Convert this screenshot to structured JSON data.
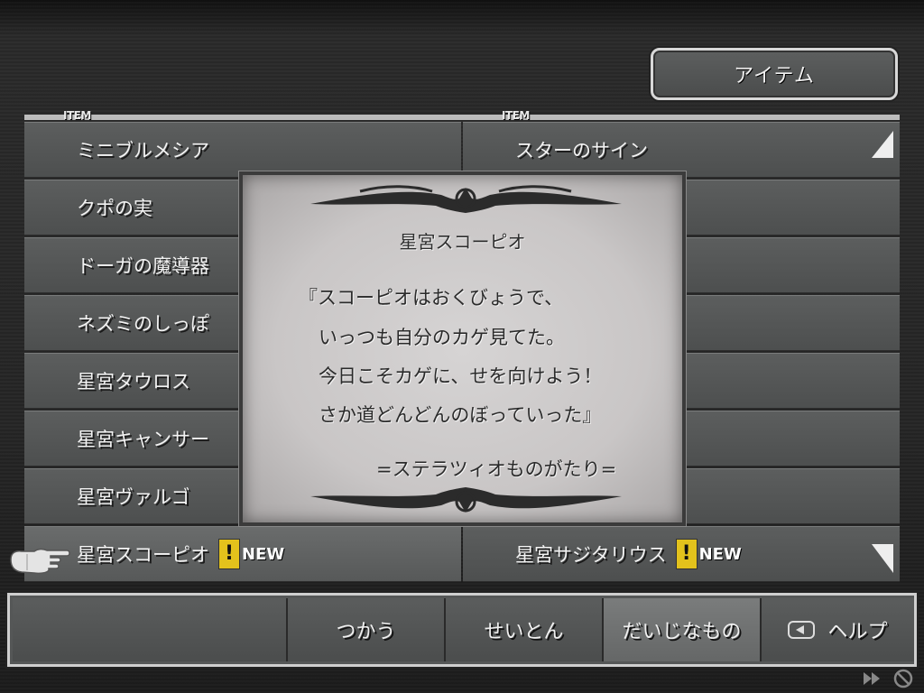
{
  "header": {
    "tab_label": "アイテム"
  },
  "columns": {
    "left_tag": "ITEM",
    "right_tag": "ITEM"
  },
  "items_left": [
    {
      "label": "ミニブルメシア",
      "new": false
    },
    {
      "label": "クポの実",
      "new": false
    },
    {
      "label": "ドーガの魔導器",
      "new": false
    },
    {
      "label": "ネズミのしっぽ",
      "new": false
    },
    {
      "label": "星宮タウロス",
      "new": false
    },
    {
      "label": "星宮キャンサー",
      "new": false
    },
    {
      "label": "星宮ヴァルゴ",
      "new": false
    },
    {
      "label": "星宮スコーピオ",
      "new": true
    }
  ],
  "items_right": [
    {
      "label": "スターのサイン",
      "new": false
    },
    {
      "label": "",
      "new": false
    },
    {
      "label": "",
      "new": false
    },
    {
      "label": "",
      "new": false
    },
    {
      "label": "",
      "new": false
    },
    {
      "label": "",
      "new": false
    },
    {
      "label": "",
      "new": false
    },
    {
      "label": "星宮サジタリウス",
      "new": true
    }
  ],
  "new_badge": {
    "mark": "!",
    "text": "NEW"
  },
  "popup": {
    "title": "星宮スコーピオ",
    "lines": [
      "『スコーピオはおくびょうで、",
      "いっつも自分のカゲ見てた。",
      "今日こそカゲに、せを向けよう！",
      "さか道どんどんのぼっていった』"
    ],
    "source": "=ステラツィオものがたり="
  },
  "bottom_menu": {
    "use": "つかう",
    "sort": "せいとん",
    "key_items": "だいじなもの",
    "help": "ヘルプ"
  },
  "colors": {
    "new_badge_bg": "#e3c21c",
    "popup_bg": "#cfcccc"
  }
}
